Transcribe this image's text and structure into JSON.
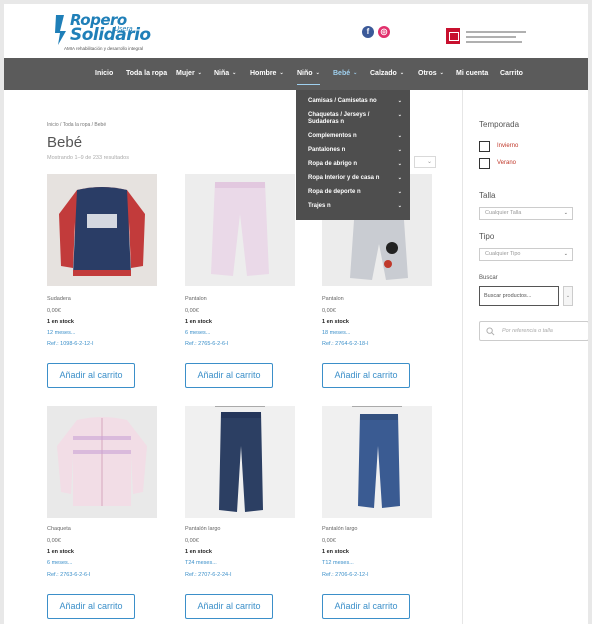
{
  "header": {
    "logo_line1": "Ropero",
    "logo_usera": "Usera",
    "logo_line2": "Solidario",
    "logo_tagline": "AMIA rehabilitación y desarrollo integral",
    "social": [
      "facebook-icon",
      "instagram-icon"
    ]
  },
  "nav": {
    "items": [
      {
        "label": "Inicio",
        "caret": false
      },
      {
        "label": "Toda la ropa",
        "caret": false
      },
      {
        "label": "Mujer",
        "caret": true
      },
      {
        "label": "Niña",
        "caret": true
      },
      {
        "label": "Hombre",
        "caret": true
      },
      {
        "label": "Niño",
        "caret": true
      },
      {
        "label": "Bebé",
        "caret": true
      },
      {
        "label": "Calzado",
        "caret": true
      },
      {
        "label": "Otros",
        "caret": true
      },
      {
        "label": "Mi cuenta",
        "caret": false
      },
      {
        "label": "Carrito",
        "caret": false
      }
    ],
    "active": "Bebé",
    "highlighted": "Niño",
    "caret_glyph": "⌄"
  },
  "dropdown": {
    "items": [
      "Camisas / Camisetas no",
      "Chaquetas / Jerseys / Sudaderas n",
      "Complementos n",
      "Pantalones n",
      "Ropa de abrigo n",
      "Ropa Interior y de casa n",
      "Ropa de deporte n",
      "Trajes n"
    ]
  },
  "main": {
    "breadcrumb": "Inicio / Toda la ropa / Bebé",
    "title": "Bebé",
    "results": "Mostrando 1–9 de 233 resultados",
    "sort_caret": "⌄"
  },
  "products": [
    {
      "name": "Sudadera",
      "price": "0,00€",
      "stock": "1 en stock",
      "size": "12 meses...",
      "ref": "Ref.: 1098-6-2-12-I",
      "button": "Añadir al carrito",
      "image": "red-navy-sweatshirt"
    },
    {
      "name": "Pantalon",
      "price": "0,00€",
      "stock": "1 en stock",
      "size": "6 meses...",
      "ref": "Ref.: 2765-6-2-6-I",
      "button": "Añadir al carrito",
      "image": "pink-pants"
    },
    {
      "name": "Pantalon",
      "price": "0,00€",
      "stock": "1 en stock",
      "size": "18 meses...",
      "ref": "Ref.: 2764-6-2-18-I",
      "button": "Añadir al carrito",
      "image": "grey-mickey-pants"
    },
    {
      "name": "Chaqueta",
      "price": "0,00€",
      "stock": "1 en stock",
      "size": "6 meses...",
      "ref": "Ref.: 2763-6-2-6-I",
      "button": "Añadir al carrito",
      "image": "pink-knit-cardigan"
    },
    {
      "name": "Pantalón largo",
      "price": "0,00€",
      "stock": "1 en stock",
      "size": "T24 meses...",
      "ref": "Ref.: 2707-6-2-24-I",
      "button": "Añadir al carrito",
      "image": "dark-jeans"
    },
    {
      "name": "Pantalón largo",
      "price": "0,00€",
      "stock": "1 en stock",
      "size": "T12 meses...",
      "ref": "Ref.: 2706-6-2-12-I",
      "button": "Añadir al carrito",
      "image": "blue-jeans"
    }
  ],
  "sidebar": {
    "temporada_title": "Temporada",
    "temporada_options": [
      "Invierno",
      "Verano"
    ],
    "talla_title": "Talla",
    "talla_placeholder": "Cualquier Talla",
    "tipo_title": "Tipo",
    "tipo_placeholder": "Cualquier Tipo",
    "buscar_title": "Buscar",
    "buscar_placeholder": "Buscar productos...",
    "ref_placeholder": "Por referencia o talla",
    "select_caret": "⌄"
  },
  "colors": {
    "nav_bg": "#5b5b5b",
    "accent_blue": "#3b8fc9",
    "brand_blue": "#1f7fb8",
    "active_nav": "#9fd0ef",
    "temporada_red": "#c0392b"
  }
}
